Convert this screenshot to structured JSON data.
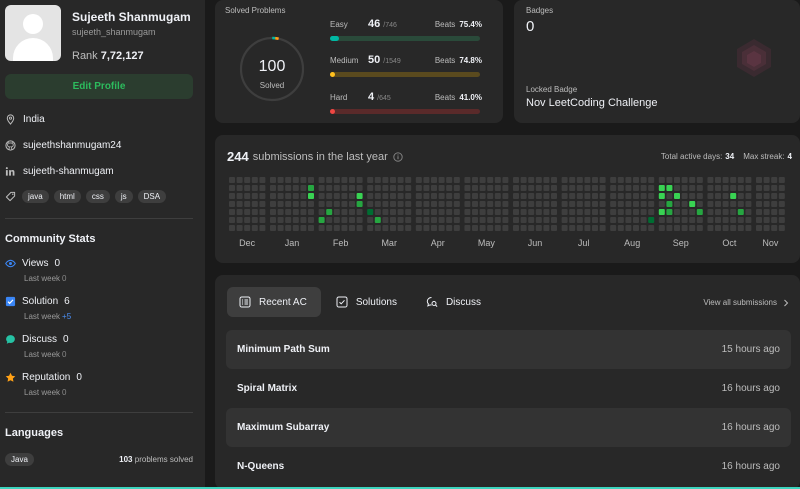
{
  "profile": {
    "name": "Sujeeth Shanmugam",
    "username": "sujeeth_shanmugam",
    "rank_label": "Rank",
    "rank_value": "7,72,127",
    "edit_label": "Edit Profile",
    "location": "India",
    "github": "sujeethshanmugam24",
    "linkedin": "sujeeth-shanmugam",
    "skills": [
      "java",
      "html",
      "css",
      "js",
      "DSA"
    ]
  },
  "community": {
    "title": "Community Stats",
    "stats": [
      {
        "label": "Views",
        "value": "0",
        "sub_label": "Last week",
        "sub_value": "0",
        "icon": "eye-icon"
      },
      {
        "label": "Solution",
        "value": "6",
        "sub_label": "Last week",
        "sub_value": "+5",
        "icon": "check-square-icon"
      },
      {
        "label": "Discuss",
        "value": "0",
        "sub_label": "Last week",
        "sub_value": "0",
        "icon": "chat-icon"
      },
      {
        "label": "Reputation",
        "value": "0",
        "sub_label": "Last week",
        "sub_value": "0",
        "icon": "star-icon"
      }
    ]
  },
  "languages": {
    "title": "Languages",
    "items": [
      {
        "name": "Java",
        "count": "103",
        "suffix": "problems solved"
      }
    ]
  },
  "solved": {
    "title": "Solved Problems",
    "total": "100",
    "total_label": "Solved",
    "difficulties": [
      {
        "name": "Easy",
        "count": "46",
        "total": "/746",
        "beats_label": "Beats",
        "beats": "75.4%",
        "fraction": 0.062,
        "color": "#00b8a3",
        "track": "#2a4a3a"
      },
      {
        "name": "Medium",
        "count": "50",
        "total": "/1549",
        "beats_label": "Beats",
        "beats": "74.8%",
        "fraction": 0.032,
        "color": "#ffc01e",
        "track": "#5a4a1e"
      },
      {
        "name": "Hard",
        "count": "4",
        "total": "/645",
        "beats_label": "Beats",
        "beats": "41.0%",
        "fraction": 0.006,
        "color": "#ef4743",
        "track": "#5a2a2a"
      }
    ]
  },
  "badges": {
    "title": "Badges",
    "count": "0",
    "locked_label": "Locked Badge",
    "locked_name": "Nov LeetCoding Challenge"
  },
  "submissions": {
    "count": "244",
    "label": "submissions in the last year",
    "active_days_label": "Total active days:",
    "active_days": "34",
    "max_streak_label": "Max streak:",
    "max_streak": "4",
    "months": [
      "Dec",
      "Jan",
      "Feb",
      "Mar",
      "Apr",
      "May",
      "Jun",
      "Jul",
      "Aug",
      "Sep",
      "Oct",
      "Nov"
    ]
  },
  "recent": {
    "tabs": [
      {
        "label": "Recent AC",
        "icon": "list-icon",
        "active": true
      },
      {
        "label": "Solutions",
        "icon": "check-square-icon",
        "active": false
      },
      {
        "label": "Discuss",
        "icon": "chat-search-icon",
        "active": false
      }
    ],
    "view_all": "View all submissions",
    "items": [
      {
        "title": "Minimum Path Sum",
        "time": "15 hours ago"
      },
      {
        "title": "Spiral Matrix",
        "time": "16 hours ago"
      },
      {
        "title": "Maximum Subarray",
        "time": "16 hours ago"
      },
      {
        "title": "N-Queens",
        "time": "16 hours ago"
      }
    ]
  },
  "colors": {
    "accent_green": "#2cbb5d",
    "easy": "#00b8a3",
    "medium": "#ffc01e",
    "hard": "#ef4743"
  }
}
